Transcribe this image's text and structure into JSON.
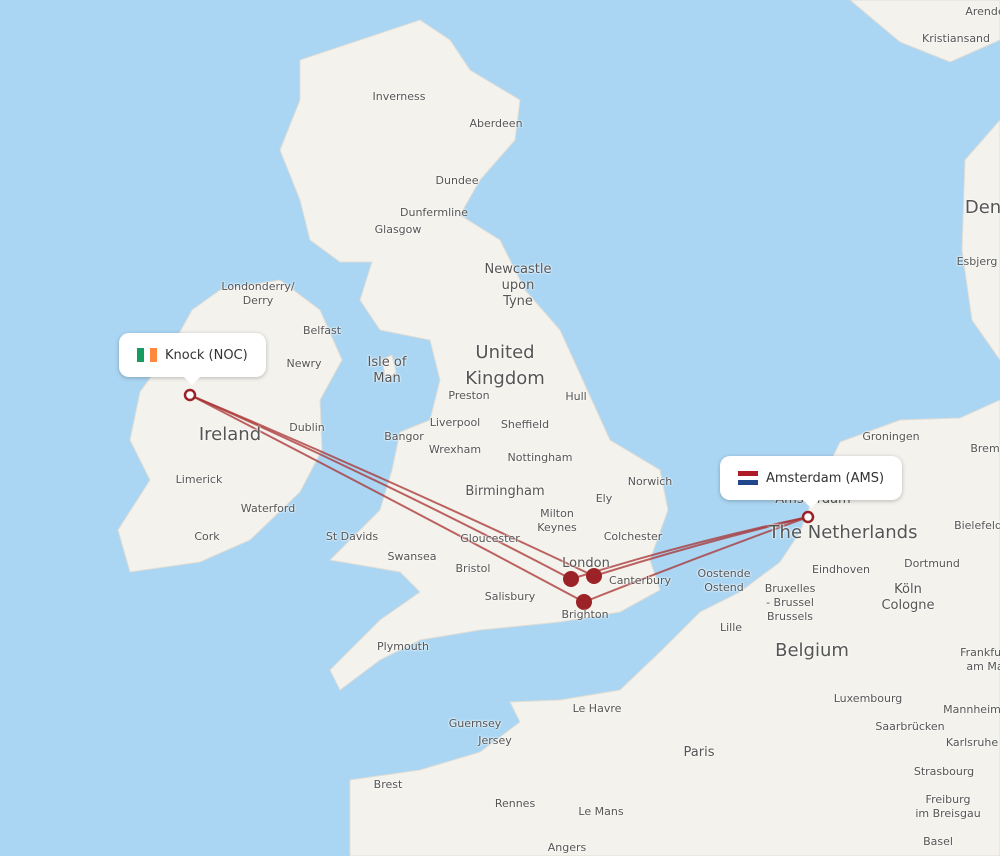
{
  "origin": {
    "label": "Knock (NOC)",
    "flag": "ireland-flag",
    "flag_colors": [
      "#169b62",
      "#ffffff",
      "#ff883e"
    ]
  },
  "destination": {
    "label": "Amsterdam (AMS)",
    "flag": "netherlands-flag",
    "flag_colors": [
      "#ae1c28",
      "#ffffff",
      "#21468b"
    ]
  },
  "colors": {
    "sea": "#aad6f3",
    "land": "#f4f2ec",
    "route": "#a83232",
    "airport": "#9b2226"
  },
  "map_labels": [
    "United\nKingdom",
    "Ireland",
    "Belgium",
    "The Netherlands",
    "Den",
    "Isle of\nMan",
    "Inverness",
    "Aberdeen",
    "Dundee",
    "Dunfermline",
    "Glasgow",
    "Newcastle\nupon\nTyne",
    "Londonderry/\nDerry",
    "Belfast",
    "Newry",
    "Preston",
    "Hull",
    "Liverpool",
    "Sheffield",
    "Bangor",
    "Dublin",
    "Wrexham",
    "Nottingham",
    "Limerick",
    "Norwich",
    "Birmingham",
    "Ely",
    "Waterford",
    "Milton\nKeynes",
    "Cork",
    "St Davids",
    "Gloucester",
    "Colchester",
    "Swansea",
    "London",
    "Bristol",
    "Canterbury",
    "Oostende\nOstend",
    "Eindhoven",
    "Dortmund",
    "Salisbury",
    "Bruxelles\n- Brussel\nBrussels",
    "Köln\nCologne",
    "Brighton",
    "Lille",
    "Plymouth",
    "Frankfurt\nam Ma",
    "Luxembourg",
    "Mannheim",
    "Le Havre",
    "Guernsey",
    "Saarbrücken",
    "Karlsruhe",
    "Jersey",
    "Paris",
    "Strasbourg",
    "Brest",
    "Rennes",
    "Le Mans",
    "Freiburg\nim Breisgau",
    "Angers",
    "Basel",
    "Groningen",
    "Brem",
    "Esbjerg",
    "Kristiansand",
    "Arende",
    "Bielefeld",
    "Amsterdam"
  ]
}
